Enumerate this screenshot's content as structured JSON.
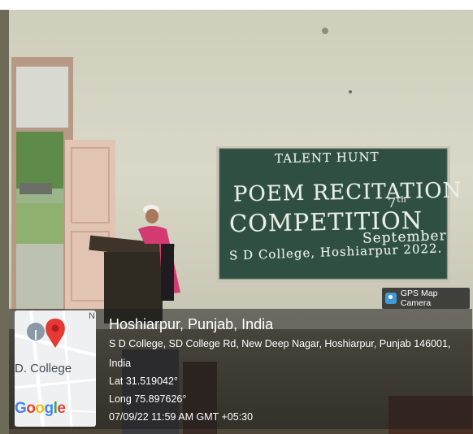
{
  "board": {
    "title": "TALENT HUNT",
    "line1": "POEM RECITATION",
    "line2": "COMPETITION",
    "date_day": "7",
    "date_suffix": "th",
    "date_month": "September",
    "line3": "S D College, Hoshiarpur 2022."
  },
  "badge": {
    "label": "GPS Map Camera",
    "icon": "camera-app-icon"
  },
  "map": {
    "place_label": "D. College",
    "compass_letter": "N",
    "provider_logo": "Google",
    "pin_icon": "map-pin-icon",
    "colors": {
      "pin": "#e53935",
      "blue": "#4285f4",
      "red": "#ea4335",
      "yellow": "#fbbc05",
      "green": "#34a853"
    }
  },
  "location": {
    "title": "Hoshiarpur, Punjab, India",
    "address_line1": "S D College, SD College Rd, New Deep Nagar, Hoshiarpur, Punjab 146001,",
    "address_line2": "India",
    "lat": "Lat 31.519042°",
    "long": "Long 75.897626°",
    "datetime": "07/09/22 11:59 AM GMT +05:30"
  },
  "colors": {
    "chalkboard": "#2f4f43",
    "wall": "#d9d7c6",
    "door": "#e3c7b4"
  }
}
